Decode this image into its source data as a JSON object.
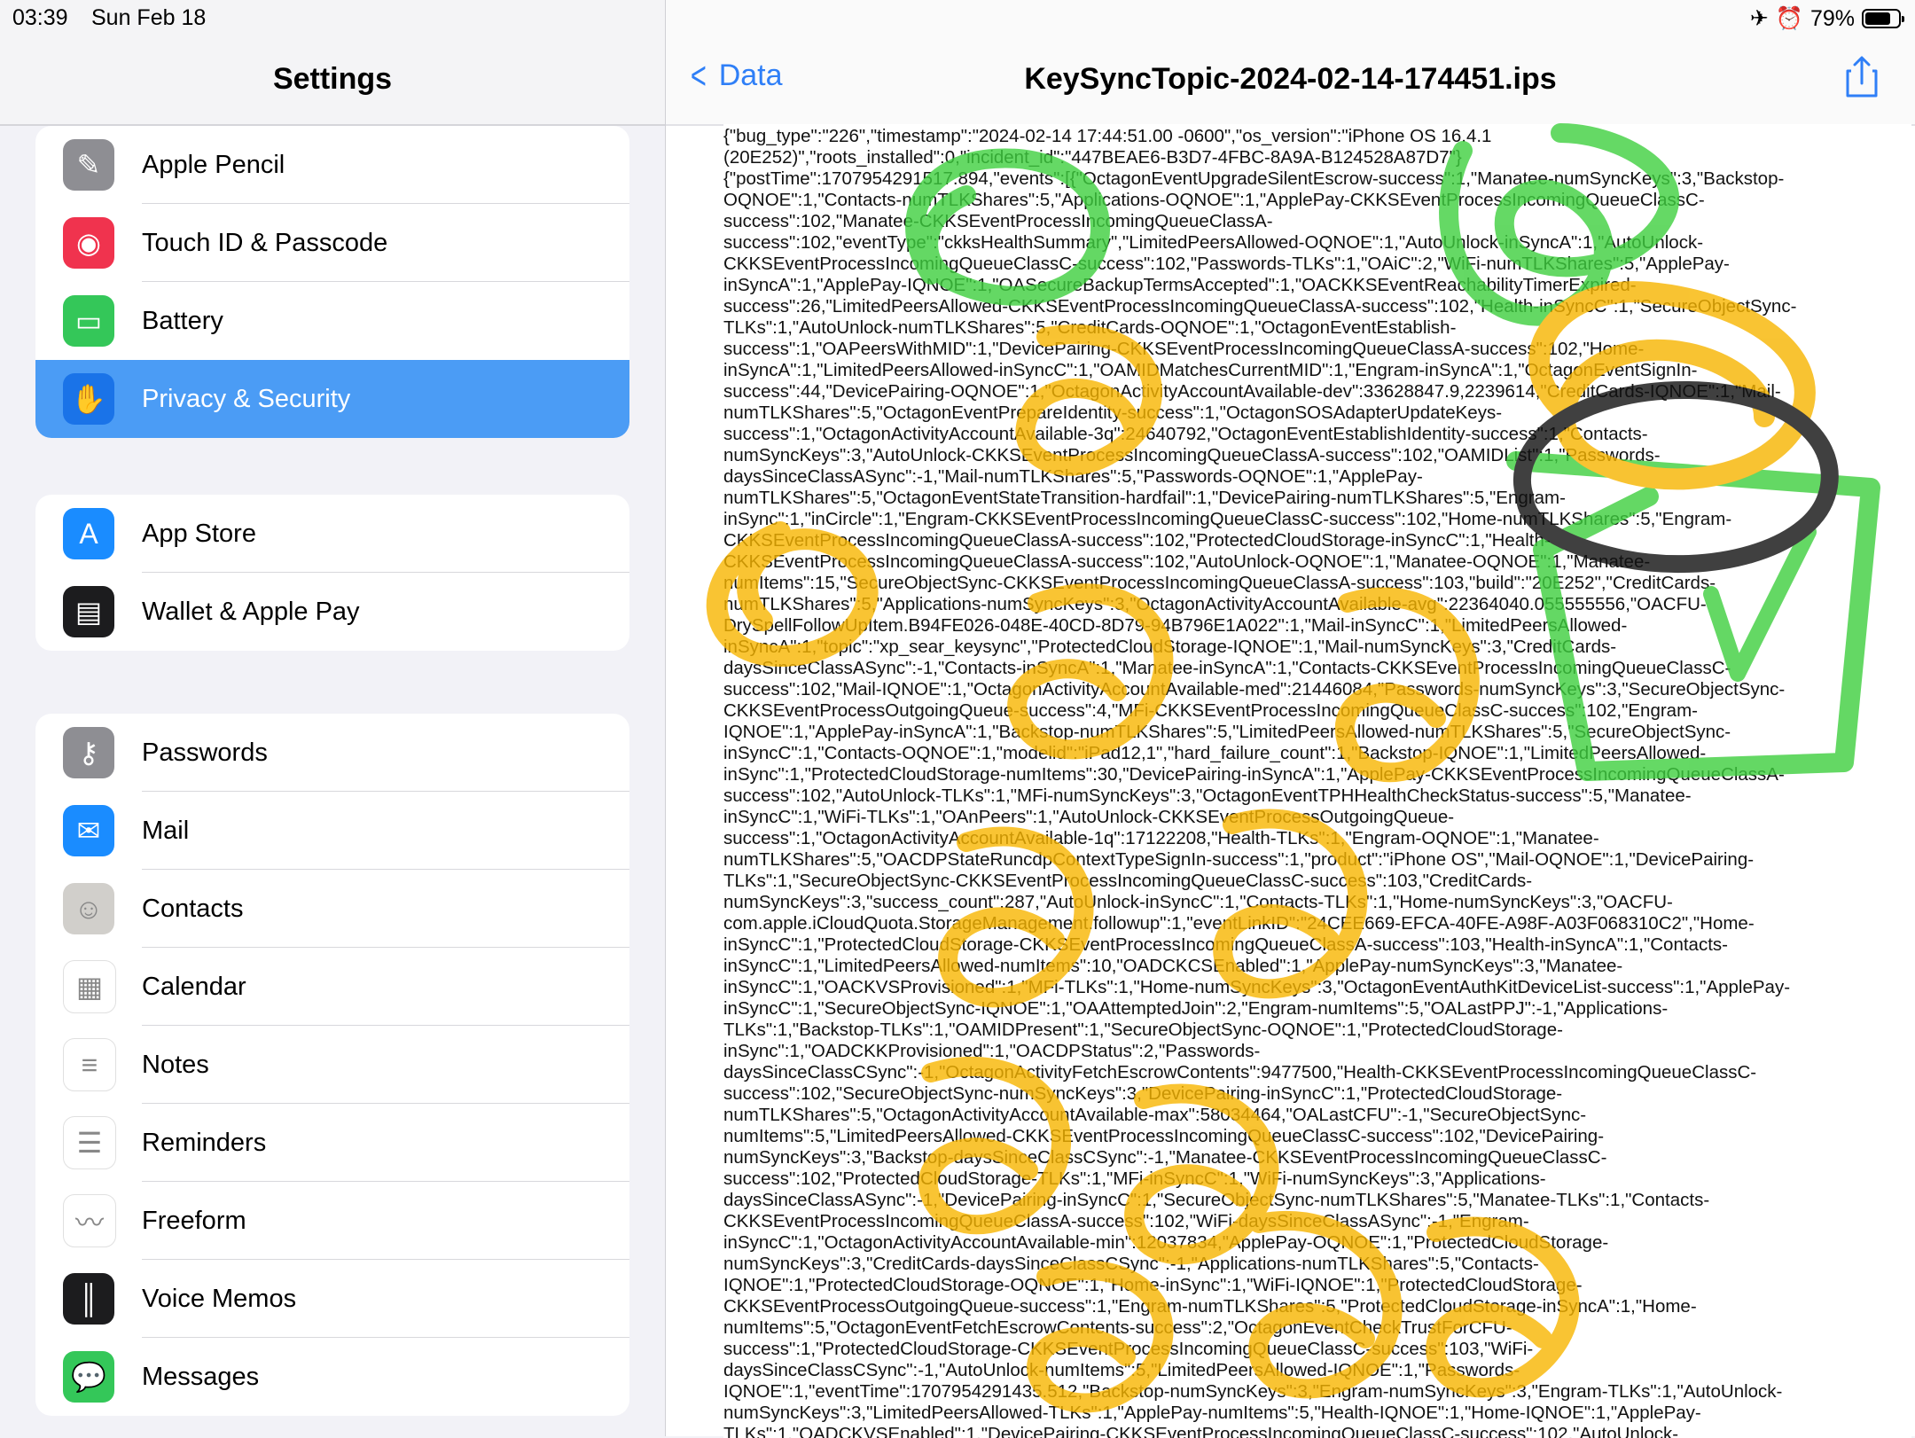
{
  "status": {
    "time": "03:39",
    "date": "Sun Feb 18",
    "battery": "79%",
    "battery_level": 0.79
  },
  "sidebar": {
    "title": "Settings",
    "group1": [
      {
        "label": "Apple Pencil",
        "icon": "pencil-icon",
        "color": "#8e8e93"
      },
      {
        "label": "Touch ID & Passcode",
        "icon": "fingerprint-icon",
        "color": "#f0334e"
      },
      {
        "label": "Battery",
        "icon": "battery-icon",
        "color": "#34c759"
      },
      {
        "label": "Privacy & Security",
        "icon": "hand-icon",
        "color": "#1a73e8",
        "selected": true
      }
    ],
    "group2": [
      {
        "label": "App Store",
        "icon": "appstore-icon",
        "color": "#1a8cff"
      },
      {
        "label": "Wallet & Apple Pay",
        "icon": "wallet-icon",
        "color": "#1c1c1e"
      }
    ],
    "group3": [
      {
        "label": "Passwords",
        "icon": "key-icon",
        "color": "#8e8e93"
      },
      {
        "label": "Mail",
        "icon": "mail-icon",
        "color": "#1a8cff"
      },
      {
        "label": "Contacts",
        "icon": "contacts-icon",
        "color": "#d1cfcb"
      },
      {
        "label": "Calendar",
        "icon": "calendar-icon",
        "color": "#ffffff"
      },
      {
        "label": "Notes",
        "icon": "notes-icon",
        "color": "#ffffff"
      },
      {
        "label": "Reminders",
        "icon": "reminders-icon",
        "color": "#ffffff"
      },
      {
        "label": "Freeform",
        "icon": "freeform-icon",
        "color": "#ffffff"
      },
      {
        "label": "Voice Memos",
        "icon": "voicememo-icon",
        "color": "#1c1c1e"
      },
      {
        "label": "Messages",
        "icon": "messages-icon",
        "color": "#34c759"
      }
    ]
  },
  "detail": {
    "back_label": "Data",
    "title": "KeySyncTopic-2024-02-14-174451.ips",
    "log_lines": [
      "{\"bug_type\":\"226\",\"timestamp\":\"2024-02-14 17:44:51.00 -0600\",\"os_version\":\"iPhone OS 16.4.1",
      "(20E252)\",\"roots_installed\":0,\"incident_id\":\"447BEAE6-B3D7-4FBC-8A9A-B124528A87D7\"}",
      "{\"postTime\":1707954291517.894,\"events\":[{\"OctagonEventUpgradeSilentEscrow-success\":1,\"Manatee-numSyncKeys\":3,\"Backstop-",
      "OQNOE\":1,\"Contacts-numTLKShares\":5,\"Applications-OQNOE\":1,\"ApplePay-CKKSEventProcessIncomingQueueClassC-",
      "success\":102,\"Manatee-CKKSEventProcessIncomingQueueClassA-",
      "success\":102,\"eventType\":\"ckksHealthSummary\",\"LimitedPeersAllowed-OQNOE\":1,\"AutoUnlock-inSyncA\":1,\"AutoUnlock-",
      "CKKSEventProcessIncomingQueueClassC-success\":102,\"Passwords-TLKs\":1,\"OAiC\":2,\"WiFi-numTLKShares\":5,\"ApplePay-",
      "inSyncA\":1,\"ApplePay-IQNOE\":1,\"OASecureBackupTermsAccepted\":1,\"OACKKSEventReachabilityTimerExpired-",
      "success\":26,\"LimitedPeersAllowed-CKKSEventProcessIncomingQueueClassA-success\":102,\"Health-inSyncC\":1,\"SecureObjectSync-",
      "TLKs\":1,\"AutoUnlock-numTLKShares\":5,\"CreditCards-OQNOE\":1,\"OctagonEventEstablish-",
      "success\":1,\"OAPeersWithMID\":1,\"DevicePairing-CKKSEventProcessIncomingQueueClassA-success\":102,\"Home-",
      "inSyncA\":1,\"LimitedPeersAllowed-inSyncC\":1,\"OAMIDMatchesCurrentMID\":1,\"Engram-inSyncA\":1,\"OctagonEventSignIn-",
      "success\":44,\"DevicePairing-OQNOE\":1,\"OctagonActivityAccountAvailable-dev\":33628847.9,2239614,\"CreditCards-IQNOE\":1,\"Mail-",
      "numTLKShares\":5,\"OctagonEventPrepareIdentity-success\":1,\"OctagonSOSAdapterUpdateKeys-",
      "success\":1,\"OctagonActivityAccountAvailable-3q\":24640792,\"OctagonEventEstablishIdentity-success\":1,\"Contacts-",
      "numSyncKeys\":3,\"AutoUnlock-CKKSEventProcessIncomingQueueClassA-success\":102,\"OAMIDList\":1,\"Passwords-",
      "daysSinceClassASync\":-1,\"Mail-numTLKShares\":5,\"Passwords-OQNOE\":1,\"ApplePay-",
      "numTLKShares\":5,\"OctagonEventStateTransition-hardfail\":1,\"DevicePairing-numTLKShares\":5,\"Engram-",
      "inSync\":1,\"inCircle\":1,\"Engram-CKKSEventProcessIncomingQueueClassC-success\":102,\"Home-numTLKShares\":5,\"Engram-",
      "CKKSEventProcessIncomingQueueClassA-success\":102,\"ProtectedCloudStorage-inSyncC\":1,\"Health-",
      "CKKSEventProcessIncomingQueueClassA-success\":102,\"AutoUnlock-OQNOE\":1,\"Manatee-OQNOE\":1,\"Manatee-",
      "numItems\":15,\"SecureObjectSync-CKKSEventProcessIncomingQueueClassA-success\":103,\"build\":\"20E252\",\"CreditCards-",
      "numTLKShares\":5,\"Applications-numSyncKeys\":3,\"OctagonActivityAccountAvailable-avg\":22364040.055555556,\"OACFU-",
      "DrySpellFollowUpItem.B94FE026-048E-40CD-8D79-94B796E1A022\":1,\"Mail-inSyncC\":1,\"LimitedPeersAllowed-",
      "inSyncA\":1,\"topic\":\"xp_sear_keysync\",\"ProtectedCloudStorage-IQNOE\":1,\"Mail-numSyncKeys\":3,\"CreditCards-",
      "daysSinceClassASync\":-1,\"Contacts-inSyncA\":1,\"Manatee-inSyncA\":1,\"Contacts-CKKSEventProcessIncomingQueueClassC-",
      "success\":102,\"Mail-IQNOE\":1,\"OctagonActivityAccountAvailable-med\":21446084,\"Passwords-numSyncKeys\":3,\"SecureObjectSync-",
      "CKKSEventProcessOutgoingQueue-success\":4,\"MFi-CKKSEventProcessIncomingQueueClassC-success\":102,\"Engram-",
      "IQNOE\":1,\"ApplePay-inSyncA\":1,\"Backstop-numTLKShares\":5,\"LimitedPeersAllowed-numTLKShares\":5,\"SecureObjectSync-",
      "inSyncC\":1,\"Contacts-OQNOE\":1,\"modelid\":\"iPad12,1\",\"hard_failure_count\":1,\"Backstop-IQNOE\":1,\"LimitedPeersAllowed-",
      "inSync\":1,\"ProtectedCloudStorage-numItems\":30,\"DevicePairing-inSyncA\":1,\"ApplePay-CKKSEventProcessIncomingQueueClassA-",
      "success\":102,\"AutoUnlock-TLKs\":1,\"MFi-numSyncKeys\":3,\"OctagonEventTPHHealthCheckStatus-success\":5,\"Manatee-",
      "inSyncC\":1,\"WiFi-TLKs\":1,\"OAnPeers\":1,\"AutoUnlock-CKKSEventProcessOutgoingQueue-",
      "success\":1,\"OctagonActivityAccountAvailable-1q\":17122208,\"Health-TLKs\":1,\"Engram-OQNOE\":1,\"Manatee-",
      "numTLKShares\":5,\"OACDPStateRuncdpContextTypeSignIn-success\":1,\"product\":\"iPhone OS\",\"Mail-OQNOE\":1,\"DevicePairing-",
      "TLKs\":1,\"SecureObjectSync-CKKSEventProcessIncomingQueueClassC-success\":103,\"CreditCards-",
      "numSyncKeys\":3,\"success_count\":287,\"AutoUnlock-inSyncC\":1,\"Contacts-TLKs\":1,\"Home-numSyncKeys\":3,\"OACFU-",
      "com.apple.iCloudQuota.StorageManagement.followup\":1,\"eventLinkID\":\"24CEE669-EFCA-40FE-A98F-A03F068310C2\",\"Home-",
      "inSyncC\":1,\"ProtectedCloudStorage-CKKSEventProcessIncomingQueueClassA-success\":103,\"Health-inSyncA\":1,\"Contacts-",
      "inSyncC\":1,\"LimitedPeersAllowed-numItems\":10,\"OADCKCSEnabled\":1,\"ApplePay-numSyncKeys\":3,\"Manatee-",
      "inSyncC\":1,\"OACKVSProvisioned\":1,\"MFi-TLKs\":1,\"Home-numSyncKeys\":3,\"OctagonEventAuthKitDeviceList-success\":1,\"ApplePay-",
      "inSyncC\":1,\"SecureObjectSync-IQNOE\":1,\"OAAttemptedJoin\":2,\"Engram-numItems\":5,\"OALastPPJ\":-1,\"Applications-",
      "TLKs\":1,\"Backstop-TLKs\":1,\"OAMIDPresent\":1,\"SecureObjectSync-OQNOE\":1,\"ProtectedCloudStorage-",
      "inSync\":1,\"OADCKKProvisioned\":1,\"OACDPStatus\":2,\"Passwords-",
      "daysSinceClassCSync\":-1,\"OctagonActivityFetchEscrowContents\":9477500,\"Health-CKKSEventProcessIncomingQueueClassC-",
      "success\":102,\"SecureObjectSync-numSyncKeys\":3,\"DevicePairing-inSyncC\":1,\"ProtectedCloudStorage-",
      "numTLKShares\":5,\"OctagonActivityAccountAvailable-max\":58034464,\"OALastCFU\":-1,\"SecureObjectSync-",
      "numItems\":5,\"LimitedPeersAllowed-CKKSEventProcessIncomingQueueClassC-success\":102,\"DevicePairing-",
      "numSyncKeys\":3,\"Backstop-daysSinceClassCSync\":-1,\"Manatee-CKKSEventProcessIncomingQueueClassC-",
      "success\":102,\"ProtectedCloudStorage-TLKs\":1,\"MFi-inSyncC\":1,\"WiFi-numSyncKeys\":3,\"Applications-",
      "daysSinceClassASync\":-1,\"DevicePairing-inSyncC\":1,\"SecureObjectSync-numTLKShares\":5,\"Manatee-TLKs\":1,\"Contacts-",
      "CKKSEventProcessIncomingQueueClassA-success\":102,\"WiFi-daysSinceClassASync\":-1,\"Engram-",
      "inSyncC\":1,\"OctagonActivityAccountAvailable-min\":12037834,\"ApplePay-OQNOE\":1,\"ProtectedCloudStorage-",
      "numSyncKeys\":3,\"CreditCards-daysSinceClassCSync\":-1,\"Applications-numTLKShares\":5,\"Contacts-",
      "IQNOE\":1,\"ProtectedCloudStorage-OQNOE\":1,\"Home-inSync\":1,\"WiFi-IQNOE\":1,\"ProtectedCloudStorage-",
      "CKKSEventProcessOutgoingQueue-success\":1,\"Engram-numTLKShares\":5,\"ProtectedCloudStorage-inSyncA\":1,\"Home-",
      "numItems\":5,\"OctagonEventFetchEscrowContents-success\":2,\"OctagonEventCheckTrustForCFU-",
      "success\":1,\"ProtectedCloudStorage-CKKSEventProcessIncomingQueueClassC-success\":103,\"WiFi-",
      "daysSinceClassCSync\":-1,\"AutoUnlock-numItems\":5,\"LimitedPeersAllowed-IQNOE\":1,\"Passwords-",
      "IQNOE\":1,\"eventTime\":1707954291435.512,\"Backstop-numSyncKeys\":3,\"Engram-numSyncKeys\":3,\"Engram-TLKs\":1,\"AutoUnlock-",
      "numSyncKeys\":3,\"LimitedPeersAllowed-TLKs\":1,\"ApplePay-numItems\":5,\"Health-IQNOE\":1,\"Home-IQNOE\":1,\"ApplePay-",
      "TLKs\":1,\"OADCKVSEnabled\":1,\"DevicePairing-CKKSEventProcessIncomingQueueClassC-success\":102,\"AutoUnlock-"
    ]
  },
  "colors": {
    "accent": "#2f7ff7",
    "selected_row": "#4b9cf5",
    "doodle_green": "#3ecf3e",
    "doodle_yellow": "#f7b500",
    "doodle_black": "#111111"
  }
}
